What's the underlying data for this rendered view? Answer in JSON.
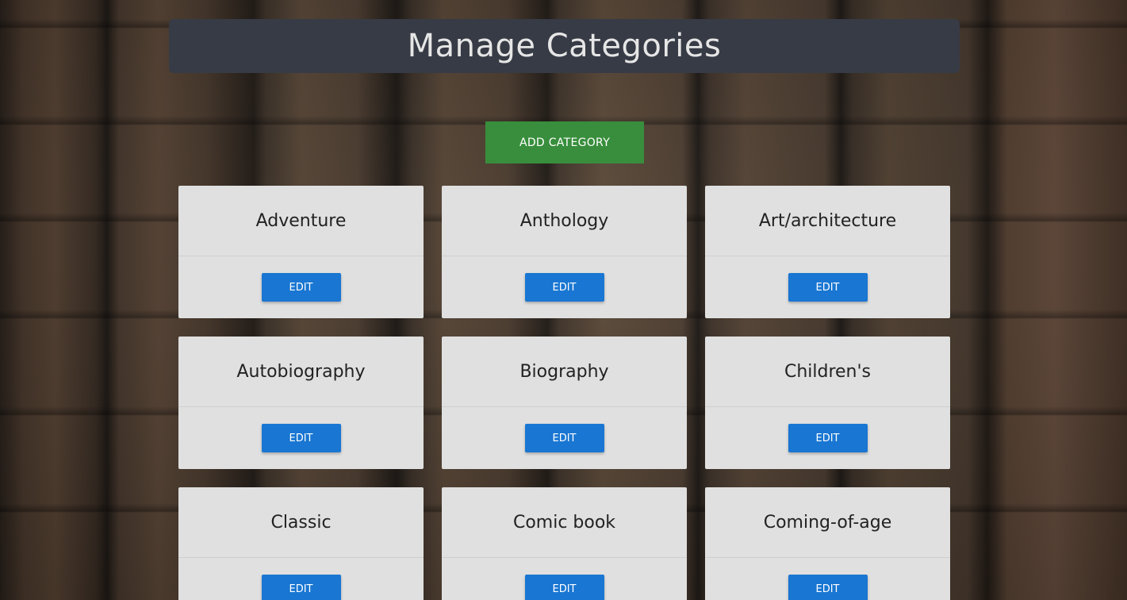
{
  "header": {
    "title": "Manage Categories"
  },
  "actions": {
    "add_label": "ADD CATEGORY"
  },
  "categories": [
    {
      "name": "Adventure",
      "edit_label": "EDIT"
    },
    {
      "name": "Anthology",
      "edit_label": "EDIT"
    },
    {
      "name": "Art/architecture",
      "edit_label": "EDIT"
    },
    {
      "name": "Autobiography",
      "edit_label": "EDIT"
    },
    {
      "name": "Biography",
      "edit_label": "EDIT"
    },
    {
      "name": "Children's",
      "edit_label": "EDIT"
    },
    {
      "name": "Classic",
      "edit_label": "EDIT"
    },
    {
      "name": "Comic book",
      "edit_label": "EDIT"
    },
    {
      "name": "Coming-of-age",
      "edit_label": "EDIT"
    }
  ],
  "colors": {
    "header_bg": "#373b45",
    "add_button": "#388e3c",
    "edit_button": "#1976d2",
    "card_bg": "#e0e0e0"
  }
}
